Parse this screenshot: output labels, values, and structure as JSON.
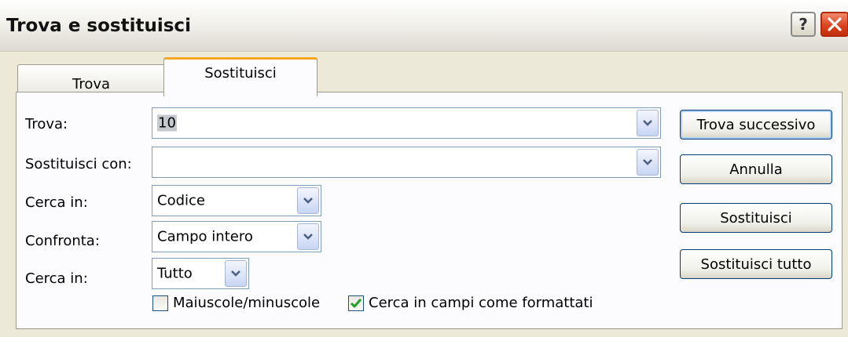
{
  "window": {
    "title": "Trova e sostituisci",
    "help_label": "?",
    "close_icon": "close-icon"
  },
  "tabs": [
    {
      "label": "Trova",
      "active": false
    },
    {
      "label": "Sostituisci",
      "active": true
    }
  ],
  "form": {
    "find": {
      "label": "Trova:",
      "value": "10"
    },
    "replace": {
      "label": "Sostituisci con:",
      "value": ""
    },
    "look_in": {
      "label": "Cerca in:",
      "value": "Codice"
    },
    "match": {
      "label": "Confronta:",
      "value": "Campo intero"
    },
    "search": {
      "label": "Cerca in:",
      "value": "Tutto"
    },
    "match_case": {
      "label": "Maiuscole/minuscole",
      "checked": false
    },
    "search_formatted": {
      "label": "Cerca in campi come formattati",
      "checked": true
    }
  },
  "buttons": {
    "find_next": "Trova successivo",
    "cancel": "Annulla",
    "replace": "Sostituisci",
    "replace_all": "Sostituisci tutto"
  },
  "colors": {
    "dialog_bg": "#ece9d8",
    "active_tab_accent": "#f5a623",
    "close_button": "#d9401c",
    "field_border": "#7f9db9",
    "checkmark": "#21a121"
  }
}
